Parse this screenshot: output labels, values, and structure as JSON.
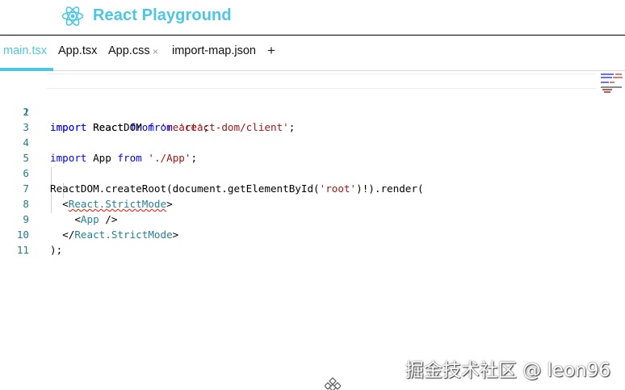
{
  "header": {
    "title": "React Playground",
    "logo_icon": "react-atom-icon",
    "accent_color": "#4bc7e3"
  },
  "tabs": [
    {
      "label": "main.tsx",
      "active": true
    },
    {
      "label": "App.tsx",
      "active": false
    },
    {
      "label": "App.css",
      "active": false,
      "close_symbol": "×"
    },
    {
      "label": "import-map.json",
      "active": false
    }
  ],
  "add_tab_symbol": "+",
  "editor": {
    "line_numbers": [
      "1",
      "2",
      "3",
      "4",
      "5",
      "6",
      "7",
      "8",
      "9",
      "10",
      "11"
    ]
  },
  "watermark": "掘金技术社区 @ leon96",
  "icons": {
    "resize_handle": "drag-handle-icon"
  }
}
